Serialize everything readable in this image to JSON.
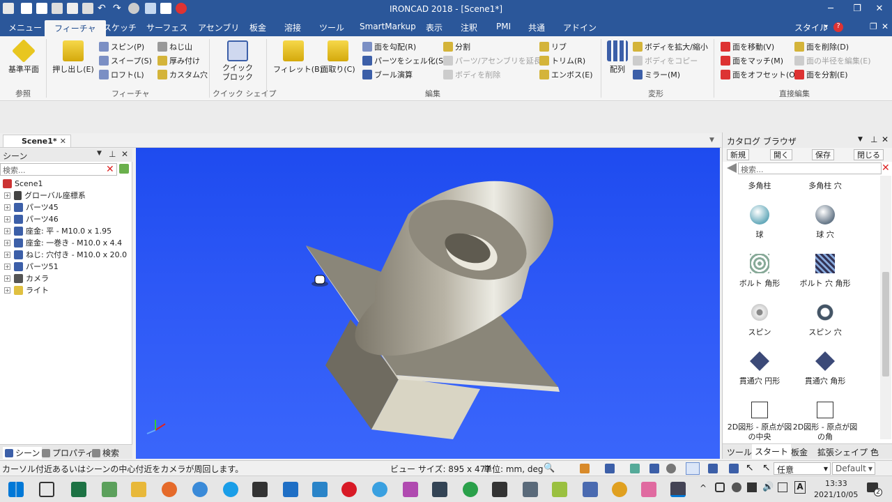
{
  "titlebar": {
    "title": "IRONCAD 2018 - [Scene1*]",
    "minimize": "─",
    "restore": "❐",
    "close": "✕"
  },
  "ribbon_tabs": [
    "メニュー",
    "フィーチャ",
    "スケッチ",
    "サーフェス",
    "アセンブリ",
    "板金",
    "溶接",
    "ツール",
    "SmartMarkup",
    "表示",
    "注釈",
    "PMI",
    "共通",
    "アドイン"
  ],
  "ribbon_right": {
    "style": "スタイル",
    "help": "?",
    "restore": "❐",
    "close": "✕"
  },
  "ribbon": {
    "ref_plane": "基準平面",
    "ref_group": "参照",
    "extrude": "押し出し(E)",
    "spin": "スピン(P)",
    "sweep": "スイープ(S)",
    "loft": "ロフト(L)",
    "thread": "ねじ山",
    "thicken": "厚み付け",
    "custom_hole": "カスタム穴",
    "feature_group": "フィーチャ",
    "quick_block": "クイック ブロック",
    "quick_group": "クイック シェイプ",
    "fillet": "フィレット(B)",
    "chamfer": "面取り(C)",
    "draft": "面を勾配(R)",
    "shell": "パーツをシェル化(S)",
    "boolean": "ブール演算",
    "split": "分割",
    "extend_parts": "パーツ/アセンブリを延長",
    "delete_body": "ボディを削除",
    "rib": "リブ",
    "trim": "トリム(R)",
    "emboss": "エンボス(E)",
    "edit_group": "編集",
    "pattern": "配列",
    "scale_body": "ボディを拡大/縮小",
    "copy_body": "ボディをコピー",
    "mirror": "ミラー(M)",
    "transform_group": "変形",
    "move_face": "面を移動(V)",
    "match_face": "面をマッチ(M)",
    "offset_face": "面をオフセット(O)",
    "delete_face": "面を削除(D)",
    "edit_radius": "面の半径を編集(E)",
    "split_face": "面を分割(E)",
    "direct_group": "直接編集"
  },
  "doc_tab": {
    "label": "Scene1*",
    "close": "✕"
  },
  "scene_panel": {
    "title": "シーン",
    "search_placeholder": "検索...",
    "items": [
      "Scene1",
      "グローバル座標系",
      "パーツ45",
      "パーツ46",
      "座金: 平 - M10.0 x 1.95",
      "座金: 一巻き - M10.0 x 4.4",
      "ねじ: 穴付き - M10.0 x 20.0",
      "パーツ51",
      "カメラ",
      "ライト"
    ],
    "bottom_tabs": [
      "シーン",
      "プロパティ",
      "検索"
    ]
  },
  "catalog": {
    "title": "カタログ ブラウザ",
    "tools": [
      "新規",
      "開く",
      "保存",
      "閉じる"
    ],
    "search_placeholder": "検索...",
    "items": [
      "多角柱",
      "多角柱 穴",
      "球",
      "球 穴",
      "ボルト 角形",
      "ボルト 穴 角形",
      "スピン",
      "スピン 穴",
      "貫通穴 円形",
      "貫通穴 角形",
      "2D図形 - 原点が図の中央",
      "2D図形 - 原点が図の角"
    ],
    "bottom_tabs": [
      "ツール",
      "スタート",
      "板金",
      "拡張シェイプ",
      "色"
    ]
  },
  "status": {
    "message": "カーソル付近あるいはシーンの中心付近をカメラが周回します。",
    "view_size": "ビュー サイズ:  895 x  477",
    "units": "単位: mm, deg",
    "select_mode": "任意",
    "style": "Default"
  },
  "taskbar": {
    "time": "13:33",
    "date": "2021/10/05",
    "notif": "2"
  },
  "colors": {
    "accent": "#2b579a",
    "viewport": "#2d58f6"
  }
}
